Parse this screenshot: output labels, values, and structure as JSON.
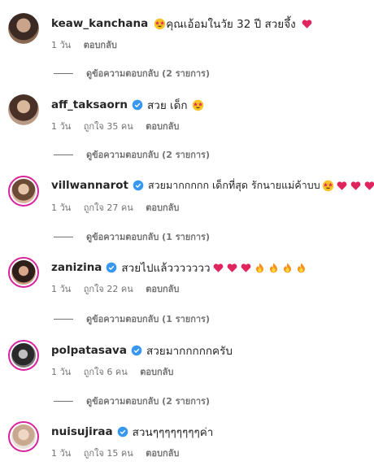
{
  "comments": [
    {
      "username": "keaw_kanchana",
      "verified": false,
      "text": "คุณเอ้อมในวัย 32 ปี สวยจึ้ง",
      "time": "1 วัน",
      "likes": "",
      "reply_label": "ตอบกลับ",
      "view_replies": "ดูข้อความตอบกลับ (2 รายการ)"
    },
    {
      "username": "aff_taksaorn",
      "verified": true,
      "text": "สวย เด็ก",
      "time": "1 วัน",
      "likes": "ถูกใจ 35 คน",
      "reply_label": "ตอบกลับ",
      "view_replies": "ดูข้อความตอบกลับ (2 รายการ)"
    },
    {
      "username": "villwannarot",
      "verified": true,
      "text": "สวยมากกกกก เด็กที่สุด รักนายแม่ค้าบบ",
      "time": "1 วัน",
      "likes": "ถูกใจ 27 คน",
      "reply_label": "ตอบกลับ",
      "view_replies": "ดูข้อความตอบกลับ (1 รายการ)"
    },
    {
      "username": "zanizina",
      "verified": true,
      "text": "สวยไปแล้ววววววว",
      "time": "1 วัน",
      "likes": "ถูกใจ 22 คน",
      "reply_label": "ตอบกลับ",
      "view_replies": "ดูข้อความตอบกลับ (1 รายการ)"
    },
    {
      "username": "polpatasava",
      "verified": true,
      "text": "สวยมากกกกกครับ",
      "time": "1 วัน",
      "likes": "ถูกใจ 6 คน",
      "reply_label": "ตอบกลับ",
      "view_replies": "ดูข้อความตอบกลับ (2 รายการ)"
    },
    {
      "username": "nuisujiraa",
      "verified": true,
      "text": "สวนๆๆๆๆๆๆๆๆค่า",
      "time": "1 วัน",
      "likes": "ถูกใจ 15 คน",
      "reply_label": "ตอบกลับ",
      "view_replies": ""
    }
  ],
  "colors": {
    "verified_badge": "#3897f0",
    "heart": "#e0245e",
    "story_ring": "#d6249f",
    "secondary_text": "#737373"
  }
}
